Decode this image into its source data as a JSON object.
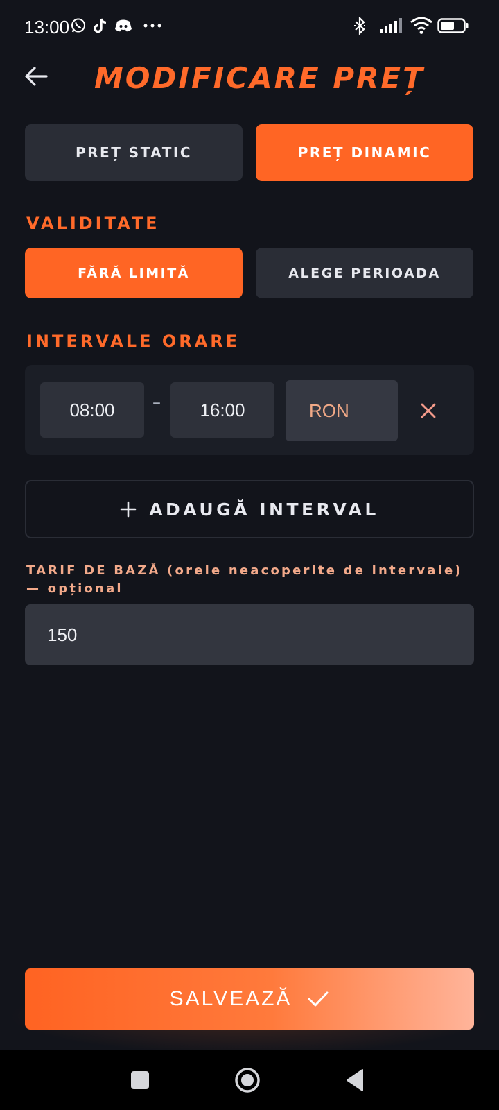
{
  "status_bar": {
    "time": "13:00",
    "left_icons": [
      "whatsapp-icon",
      "tiktok-icon",
      "discord-icon",
      "more-dots-icon"
    ],
    "right_icons": [
      "bluetooth-icon",
      "signal-icon",
      "wifi-icon",
      "battery-icon"
    ],
    "battery_level": 0.55
  },
  "header": {
    "title": "MODIFICARE PREȚ",
    "back_icon": "arrow-left-icon"
  },
  "price_type": {
    "static_label": "PREȚ STATIC",
    "dynamic_label": "PREȚ DINAMIC",
    "selected": "dynamic"
  },
  "validity": {
    "section_title": "VALIDITATE",
    "no_limit_label": "FĂRĂ LIMITĂ",
    "choose_period_label": "ALEGE PERIOADA",
    "selected": "no_limit"
  },
  "intervals": {
    "section_title": "INTERVALE ORARE",
    "items": [
      {
        "start": "08:00",
        "separator": "–",
        "end": "16:00",
        "price_placeholder": "RON",
        "price_value": ""
      }
    ],
    "add_label": "ADAUGĂ INTERVAL"
  },
  "base_tariff": {
    "label": "TARIF DE BAZĂ (orele neacoperite de intervale) — opțional",
    "value": "150"
  },
  "save": {
    "label": "SALVEAZĂ"
  },
  "nav_bar": {
    "items": [
      "recents-square-icon",
      "home-circle-icon",
      "back-triangle-icon"
    ]
  },
  "colors": {
    "accent": "#ff6524",
    "background": "#12141b",
    "button_off": "#2a2d36",
    "remove_icon": "#f29a8a",
    "label_peach": "#f2a98a"
  }
}
